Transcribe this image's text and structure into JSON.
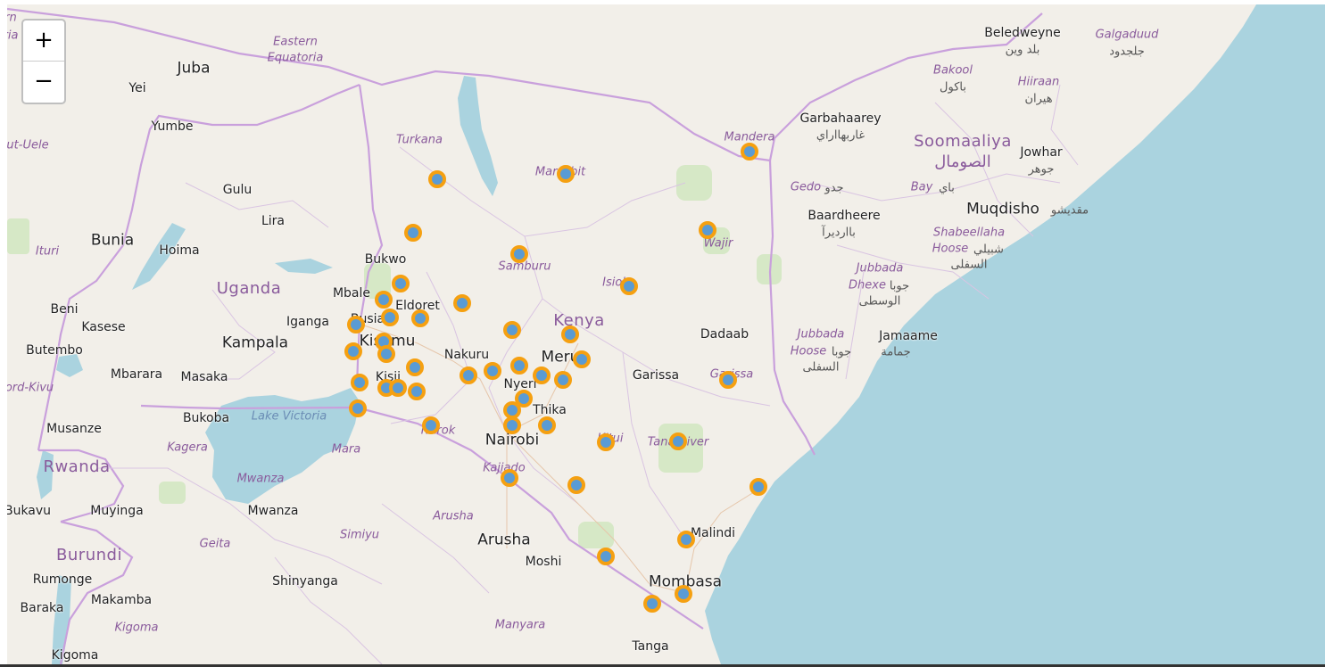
{
  "zoom": {
    "in_label": "+",
    "out_label": "−"
  },
  "colors": {
    "land": "#f2efe9",
    "water": "#aad3df",
    "border": "#c9a0dc",
    "marker_ring": "#f5a011",
    "marker_fill": "#5a9bd4"
  },
  "labels": {
    "juba": "Juba",
    "yei": "Yei",
    "yumbe": "Yumbe",
    "gulu": "Gulu",
    "lira": "Lira",
    "bunia": "Bunia",
    "hoima": "Hoima",
    "uganda": "Uganda",
    "mbale": "Mbale",
    "bukwo": "Bukwo",
    "busia": "Busia",
    "eldoret": "Eldoret",
    "kisumu": "Kisumu",
    "iganga": "Iganga",
    "kampala": "Kampala",
    "beni": "Beni",
    "kasese": "Kasese",
    "butembo": "Butembo",
    "mbarara": "Mbarara",
    "masaka": "Masaka",
    "kisii": "Kisii",
    "bukoba": "Bukoba",
    "musanze": "Musanze",
    "rwanda": "Rwanda",
    "bukavu": "Bukavu",
    "muyinga": "Muyinga",
    "mwanza": "Mwanza",
    "burundi": "Burundi",
    "rumonge": "Rumonge",
    "makamba": "Makamba",
    "baraka": "Baraka",
    "kigoma": "Kigoma",
    "shinyanga": "Shinyanga",
    "arusha": "Arusha",
    "moshi": "Moshi",
    "tanga": "Tanga",
    "mombasa": "Mombasa",
    "malindi": "Malindi",
    "nairobi": "Nairobi",
    "thika": "Thika",
    "nyeri": "Nyeri",
    "nakuru": "Nakuru",
    "meru": "Meru",
    "kenya": "Kenya",
    "garissa": "Garissa",
    "dadaab": "Dadaab",
    "jamaame": "Jamaame",
    "jamaame_ar": "جمامة",
    "muqdisho": "Muqdisho",
    "muqdisho_ar": "مقديشو",
    "jowhar": "Jowhar",
    "jowhar_ar": "جوهر",
    "baardheere": "Baardheere",
    "baardheere_ar": "باارديرآ",
    "garbahaarey": "Garbahaarey",
    "garbahaarey_ar": "غاربهااراي",
    "beledweyne": "Beledweyne",
    "beledweyne_ar": "بلد وين",
    "soomaaliya": "Soomaaliya",
    "soomaaliya_ar": "الصومال"
  },
  "regions": {
    "eastern_equatoria_1": "Eastern",
    "eastern_equatoria_2": "Equatoria",
    "turkana": "Turkana",
    "marsabit": "Marsabit",
    "mandera": "Mandera",
    "samburu": "Samburu",
    "isiolo": "Isiolo",
    "wajir": "Wajir",
    "garissa_r": "Garissa",
    "gedo": "Gedo",
    "gedo_ar": "جدو",
    "bay": "Bay",
    "bay_ar": "باي",
    "bakool": "Bakool",
    "bakool_ar": "باكول",
    "hiiraan": "Hiiraan",
    "hiiraan_ar": "هيران",
    "galgaduud": "Galgaduud",
    "galgaduud_ar": "جلجدود",
    "shabeellaha_1": "Shabeellaha",
    "shabeellaha_2": "Hoose",
    "shabeellaha_ar1": "شبيلي",
    "shabeellaha_ar2": "السفلى",
    "jubbada_dhexe_1": "Jubbada",
    "jubbada_dhexe_2": "Dhexe",
    "jubbada_dhexe_ar1": "جوبا",
    "jubbada_dhexe_ar2": "الوسطى",
    "jubbada_hoose_1": "Jubbada",
    "jubbada_hoose_2": "Hoose",
    "jubbada_hoose_ar1": "جوبا",
    "jubbada_hoose_ar2": "السفلى",
    "ituri": "Ituri",
    "nord_kivu": "ord-Kivu",
    "haut_uele": "ut-Uele",
    "narok": "Narok",
    "kitui": "Kitui",
    "tana_river": "Tana River",
    "kajiado": "Kajiado",
    "kagera": "Kagera",
    "mara": "Mara",
    "mwanza_r": "Mwanza",
    "geita": "Geita",
    "simiyu": "Simiyu",
    "arusha_r": "Arusha",
    "manyara": "Manyara",
    "kigoma_r": "Kigoma",
    "western_cut": "ern",
    "western_cut2": "oria"
  },
  "water": {
    "lake_victoria": "Lake Victoria"
  }
}
